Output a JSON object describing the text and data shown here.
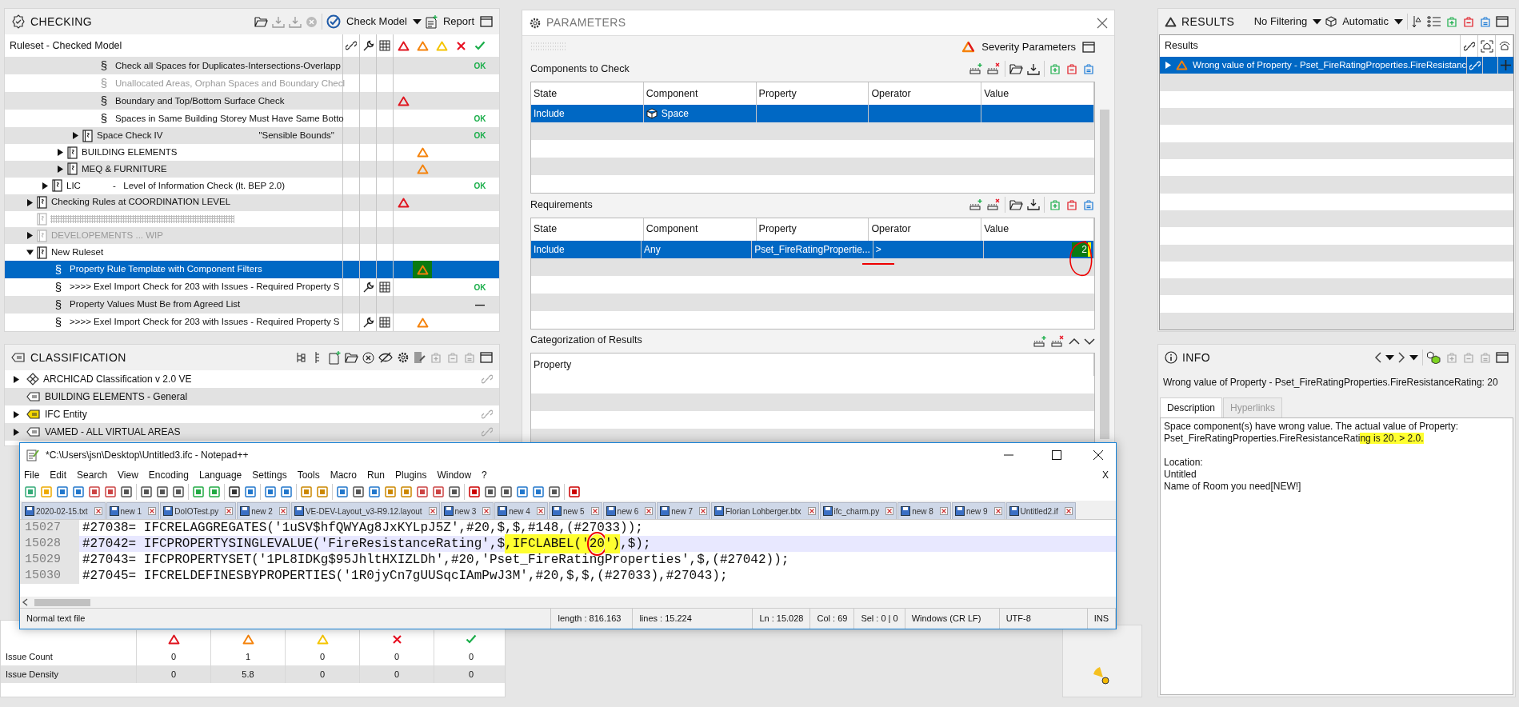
{
  "checking": {
    "title": "CHECKING",
    "check_model": "Check Model",
    "report": "Report",
    "name_column": "Ruleset - Checked Model",
    "rows": [
      {
        "children": [
          {
            "children": [
              {
                "children": [
                  {
                    "children": [
                      {
                        "kind": "rule",
                        "symbol": "§",
                        "label": "Check all Spaces for Duplicates-Intersections-Overlapp",
                        "disabled": false,
                        "selected": false,
                        "status": {
                          "kind": "passed",
                          "text": "OK"
                        }
                      },
                      {
                        "kind": "rule",
                        "symbol": "§",
                        "label": "Unallocated Areas, Orphan Spaces and Boundary Checl",
                        "disabled": true,
                        "selected": false
                      },
                      {
                        "kind": "rule",
                        "symbol": "§",
                        "label": "Boundary and Top/Bottom Surface Check",
                        "disabled": false,
                        "selected": false,
                        "status": {
                          "kind": "critical"
                        }
                      },
                      {
                        "kind": "rule",
                        "symbol": "§",
                        "label": "Spaces in Same Building Storey Must Have Same Botto",
                        "disabled": false,
                        "selected": false,
                        "status": {
                          "kind": "passed",
                          "text": "OK"
                        }
                      }
                    ]
                  },
                  {
                    "kind": "ruleset",
                    "label": "Space Check  IV",
                    "note": "\"Sensible Bounds\"",
                    "expanded": false,
                    "disabled": false,
                    "selected": false,
                    "status": {
                      "kind": "passed",
                      "text": "OK"
                    }
                  }
                ]
              },
              {
                "kind": "ruleset",
                "label": "BUILDING ELEMENTS",
                "expanded": false,
                "disabled": false,
                "selected": false,
                "status": {
                  "kind": "moderate"
                }
              },
              {
                "kind": "ruleset",
                "label": "MEQ & FURNITURE",
                "expanded": false,
                "disabled": false,
                "selected": false,
                "status": {
                  "kind": "moderate"
                }
              }
            ]
          },
          {
            "kind": "ruleset",
            "label": "LIC",
            "note": "-   Level of Information Check (lt. BEP 2.0)",
            "expanded": false,
            "disabled": false,
            "selected": false,
            "status": {
              "kind": "passed",
              "text": "OK"
            }
          }
        ]
      },
      {
        "kind": "ruleset",
        "label": "Checking Rules at COORDINATION LEVEL",
        "expanded": false,
        "disabled": false,
        "selected": false,
        "status": {
          "kind": "critical"
        }
      },
      {
        "kind": "ruleset",
        "disabled": true,
        "selected": false
      },
      {
        "kind": "ruleset",
        "label": "DEVELOPEMENTS ... WIP",
        "expanded": false,
        "disabled": true,
        "selected": false
      },
      {
        "kind": "ruleset",
        "label": "New Ruleset",
        "expanded": true,
        "disabled": false,
        "selected": false,
        "children": [
          {
            "kind": "rule",
            "symbol": "§",
            "label": "Property Rule Template with Component Filters",
            "disabled": false,
            "selected": true,
            "tools": false,
            "status": {
              "kind": "moderate"
            }
          },
          {
            "kind": "rule",
            "symbol": "§",
            "label": ">>>> Exel Import Check for 203 with Issues - Required Property S",
            "disabled": false,
            "selected": false,
            "tools": true,
            "status": {
              "kind": "passed",
              "text": "OK"
            }
          },
          {
            "kind": "rule",
            "symbol": "§",
            "label": "Property Values Must Be from Agreed List",
            "disabled": false,
            "selected": false,
            "tools": false,
            "status": {
              "kind": "not_run",
              "text": "—"
            }
          },
          {
            "kind": "rule",
            "symbol": "§",
            "label": ">>>> Exel Import Check for 203 with Issues - Required Property S",
            "disabled": false,
            "selected": false,
            "tools": true,
            "status": {
              "kind": "moderate"
            }
          }
        ]
      }
    ]
  },
  "classification": {
    "title": "CLASSIFICATION",
    "rows": [
      {
        "kind": "system",
        "label": "ARCHICAD Classification v 2.0 VE",
        "expanded": false,
        "linked": true
      },
      {
        "kind": "tag",
        "label": "BUILDING ELEMENTS - General",
        "color": "#ffffff",
        "linked": false
      },
      {
        "kind": "tag",
        "label": "IFC Entity",
        "color": "#f5d800",
        "expanded": false,
        "linked": true
      },
      {
        "kind": "tag",
        "label": "VAMED - ALL VIRTUAL AREAS",
        "color": "#ffffff",
        "expanded": false,
        "linked": true
      }
    ]
  },
  "parameters": {
    "title": "PARAMETERS",
    "severity_button": "Severity Parameters",
    "components": {
      "title": "Components to Check",
      "columns": [
        "State",
        "Component",
        "Property",
        "Operator",
        "Value"
      ],
      "rows": [
        {
          "state": "Include",
          "component": "Space",
          "icon": {
            "kind": "cube"
          },
          "selected": true,
          "annotated": false
        }
      ]
    },
    "requirements": {
      "title": "Requirements",
      "columns": [
        "State",
        "Component",
        "Property",
        "Operator",
        "Value"
      ],
      "rows": [
        {
          "state": "Include",
          "component": "Any",
          "property": "Pset_FireRatingPropertie...",
          "operator": ">",
          "value": "2",
          "selected": true,
          "annotated": true
        }
      ]
    },
    "categorization": {
      "title": "Categorization of Results",
      "columns": [
        "Property"
      ]
    }
  },
  "results": {
    "title": "RESULTS",
    "filter": "No Filtering",
    "mode": "Automatic",
    "column": "Results",
    "rows": [
      {
        "label": "Wrong value of Property - Pset_FireRatingProperties.FireResistanc",
        "status": {
          "kind": "moderate"
        },
        "selected": true
      }
    ]
  },
  "info": {
    "title": "INFO",
    "heading": "Wrong value of Property - Pset_FireRatingProperties.FireResistanceRating: 20",
    "tabs": [
      {
        "label": "Description",
        "selected": true
      },
      {
        "label": "Hyperlinks",
        "selected": false
      }
    ],
    "description": [
      {
        "lines": [
          [
            {
              "text": "Space component(s) have wrong value. The actual value of Property:",
              "highlight": false
            }
          ],
          [
            {
              "text": "Pset_FireRatingProperties.FireResistanceRati",
              "highlight": false
            },
            {
              "text": "ng is 20. > 2.0.",
              "highlight": true
            }
          ]
        ]
      },
      {
        "lines": [
          [
            {
              "text": "Location:",
              "highlight": false
            }
          ],
          [
            {
              "text": "Untitled",
              "highlight": false
            }
          ],
          [
            {
              "text": "Name of Room you need[NEW!]",
              "highlight": false
            }
          ]
        ]
      }
    ]
  },
  "notepad": {
    "title": "*C:\\Users\\jsn\\Desktop\\Untitled3.ifc - Notepad++",
    "menu": [
      "File",
      "Edit",
      "Search",
      "View",
      "Encoding",
      "Language",
      "Settings",
      "Tools",
      "Macro",
      "Run",
      "Plugins",
      "Window",
      "?"
    ],
    "menu_close": "X",
    "tabs": [
      "2020-02-15.txt",
      "new 1",
      "DoIOTest.py",
      "new 2",
      "VE-DEV-Layout_v3-R9.12.layout",
      "new 3",
      "new 4",
      "new 5",
      "new 6",
      "new 7",
      "Florian Lohberger.btx",
      "ifc_charm.py",
      "new 8",
      "new 9",
      "Untitled2.if"
    ],
    "lines": [
      {
        "number": "15027",
        "current": false,
        "segments": [
          {
            "text": "#27038= IFCRELAGGREGATES('1uSV$hfQWYAg8JxKYLpJ5Z',#20,$,$,#148,(#27033));",
            "highlight": false,
            "circled": false
          }
        ]
      },
      {
        "number": "15028",
        "current": true,
        "segments": [
          {
            "text": "#27042= IFCPROPERTYSINGLEVALUE('FireResistanceRating',$",
            "highlight": false,
            "circled": false
          },
          {
            "text": ",IFCLABEL('",
            "highlight": true,
            "circled": false
          },
          {
            "text": "20",
            "highlight": true,
            "circled": true
          },
          {
            "text": "')",
            "highlight": true,
            "circled": false
          },
          {
            "text": ",$);",
            "highlight": false,
            "circled": false
          }
        ]
      },
      {
        "number": "15029",
        "current": false,
        "segments": [
          {
            "text": "#27043= IFCPROPERTYSET('1PL8IDKg$95JhltHXIZLDh',#20,'Pset_FireRatingProperties',$,(#27042));",
            "highlight": false,
            "circled": false
          }
        ]
      },
      {
        "number": "15030",
        "current": false,
        "segments": [
          {
            "text": "#27045= IFCRELDEFINESBYPROPERTIES('1R0jyCn7gUUSqcIAmPwJ3M',#20,$,$,(#27033),#27043);",
            "highlight": false,
            "circled": false
          }
        ]
      }
    ],
    "status": [
      "Normal text file",
      "length : 816.163",
      "lines : 15.224",
      "Ln : 15.028",
      "Col : 69",
      "Sel : 0 | 0",
      "Windows (CR LF)",
      "UTF-8",
      "INS"
    ]
  },
  "summary": {
    "columns": [
      {
        "kind": "critical"
      },
      {
        "kind": "moderate"
      },
      {
        "kind": "minor"
      },
      {
        "kind": "error"
      },
      {
        "kind": "passed"
      }
    ],
    "rows": [
      {
        "label": "Issue Count",
        "values": [
          "0",
          "1",
          "0",
          "0",
          "0"
        ]
      },
      {
        "label": "Issue Density",
        "values": [
          "0",
          "5.8",
          "0",
          "0",
          "0"
        ]
      }
    ]
  }
}
